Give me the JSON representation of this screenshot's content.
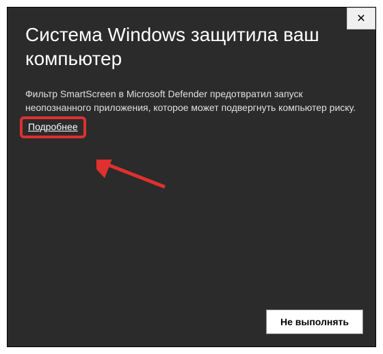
{
  "dialog": {
    "title": "Система Windows защитила ваш компьютер",
    "body": "Фильтр SmartScreen в Microsoft Defender предотвратил запуск неопознанного приложения, которое может подвергнуть компьютер риску.",
    "more_link": "Подробнее",
    "cancel_button": "Не выполнять",
    "close_icon": "✕"
  },
  "annotation": {
    "highlight_color": "#e03030",
    "arrow_color": "#e03030"
  }
}
